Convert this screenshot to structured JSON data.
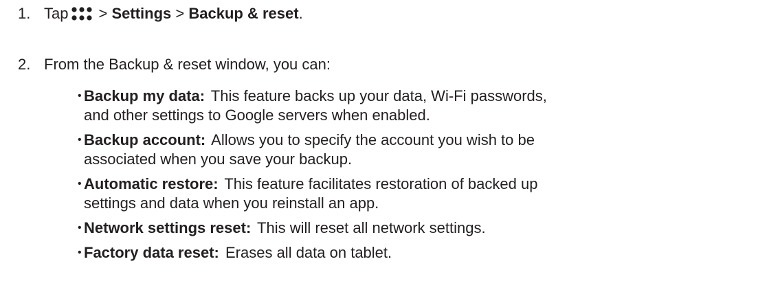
{
  "steps": [
    {
      "number": "1.",
      "prefix": "Tap",
      "icon": "apps-grid-icon",
      "sep1": ">",
      "settings": "Settings",
      "sep2": ">",
      "backup": "Backup & reset",
      "end": "."
    },
    {
      "number": "2.",
      "text": "From the Backup & reset window, you can:"
    }
  ],
  "bullets": [
    {
      "term": "Backup my data:",
      "desc": "This feature backs up your data, Wi-Fi passwords, and other settings to Google servers when enabled."
    },
    {
      "term": "Backup account:",
      "desc": "Allows you to specify the account you wish to be associated when you save your backup."
    },
    {
      "term": "Automatic restore:",
      "desc": "This feature facilitates restoration of backed up settings and data when you reinstall an app."
    },
    {
      "term": "Network settings reset:",
      "desc": "This will reset all network settings."
    },
    {
      "term": "Factory data reset:",
      "desc": "Erases all data on tablet."
    }
  ],
  "bullet_symbol": "•",
  "colors": {
    "text": "#231f20"
  }
}
